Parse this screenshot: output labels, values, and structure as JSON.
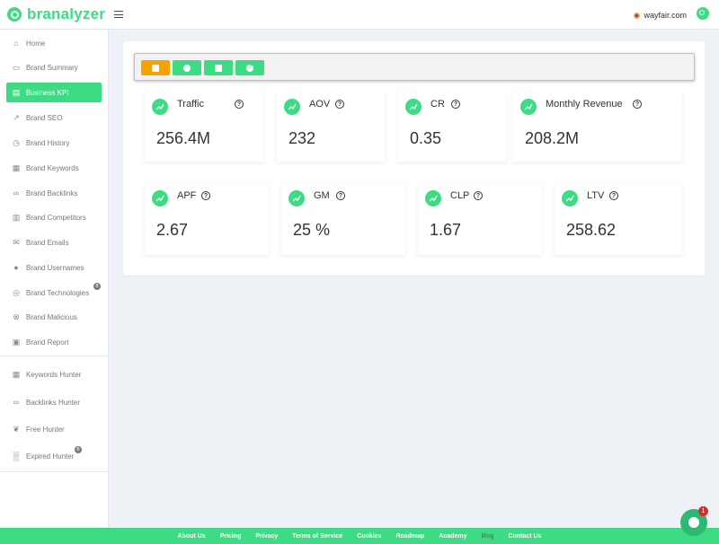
{
  "brand": {
    "name": "branalyzer"
  },
  "header": {
    "domain": "wayfair.com"
  },
  "sidebar": {
    "items": [
      {
        "label": "Home",
        "icon": "home-icon",
        "glyph": "⌂"
      },
      {
        "label": "Brand Summary",
        "icon": "summary-icon",
        "glyph": "▭"
      },
      {
        "label": "Business KPI",
        "icon": "chart-icon",
        "glyph": "▤"
      },
      {
        "label": "Brand SEO",
        "icon": "seo-icon",
        "glyph": "↗"
      },
      {
        "label": "Brand History",
        "icon": "history-icon",
        "glyph": "◷"
      },
      {
        "label": "Brand Keywords",
        "icon": "keyboard-icon",
        "glyph": "▦"
      },
      {
        "label": "Brand Backlinks",
        "icon": "link-icon",
        "glyph": "∞"
      },
      {
        "label": "Brand Competitors",
        "icon": "building-icon",
        "glyph": "▥"
      },
      {
        "label": "Brand Emails",
        "icon": "mail-icon",
        "glyph": "✉"
      },
      {
        "label": "Brand Usernames",
        "icon": "user-icon",
        "glyph": "●"
      },
      {
        "label": "Brand Technologies",
        "icon": "tech-icon",
        "glyph": "◎"
      },
      {
        "label": "Brand Malicious",
        "icon": "malicious-icon",
        "glyph": "⊗"
      },
      {
        "label": "Brand Report",
        "icon": "report-icon",
        "glyph": "▣"
      },
      {
        "label": "Keywords Hunter",
        "icon": "keyboard-icon",
        "glyph": "▦"
      },
      {
        "label": "Backlinks Hunter",
        "icon": "link-icon",
        "glyph": "∞"
      },
      {
        "label": "Free Hunter",
        "icon": "hunter-icon",
        "glyph": "❦"
      },
      {
        "label": "Expired Hunter",
        "icon": "expired-icon",
        "glyph": "▒"
      }
    ],
    "badge_technologies": "B",
    "badge_expired": "B"
  },
  "kpis": [
    {
      "label": "Traffic",
      "value": "256.4M"
    },
    {
      "label": "AOV",
      "value": "232"
    },
    {
      "label": "CR",
      "value": "0.35"
    },
    {
      "label": "Monthly Revenue",
      "value": "208.2M"
    },
    {
      "label": "APF",
      "value": "2.67"
    },
    {
      "label": "GM",
      "value": "25 %"
    },
    {
      "label": "CLP",
      "value": "1.67"
    },
    {
      "label": "LTV",
      "value": "258.62"
    }
  ],
  "help_glyph": "?",
  "footer": {
    "links": [
      "About Us",
      "Pricing",
      "Privacy",
      "Terms of Service",
      "Cookies",
      "Roadmap",
      "Academy",
      "Blog",
      "Contact Us"
    ]
  },
  "chat": {
    "badge": "1"
  },
  "colors": {
    "accent": "#3ddc84",
    "orange": "#f5a300"
  }
}
